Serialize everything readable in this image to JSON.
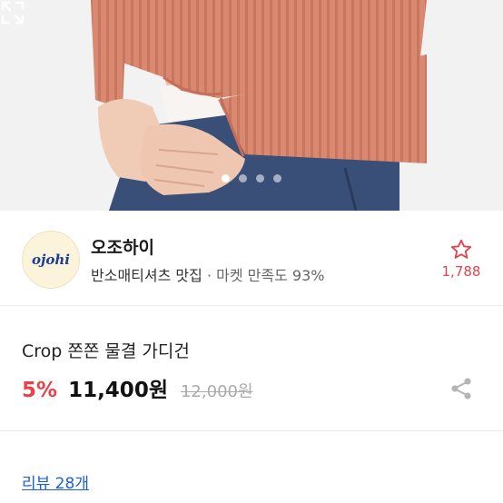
{
  "gallery": {
    "slide_count": 4,
    "active_index": 0,
    "expand_icon": "expand-icon"
  },
  "shop": {
    "logo_text": "ojohi",
    "name": "오조하이",
    "tagline": "반소매티셔츠 맛집",
    "separator": " · ",
    "satisfaction": "마켓 만족도 93%",
    "like_icon": "star-outline-icon",
    "like_count": "1,788"
  },
  "product": {
    "title": "Crop 쫀쫀 물결 가디건",
    "discount": "5%",
    "price": "11,400원",
    "original_price": "12,000원",
    "share_icon": "share-icon"
  },
  "reviews": {
    "link_text": "리뷰 28개"
  },
  "colors": {
    "accent_red": "#e8414b",
    "link_blue": "#1c5fd6",
    "cardigan": "#d98a72",
    "denim": "#3a4f78"
  }
}
